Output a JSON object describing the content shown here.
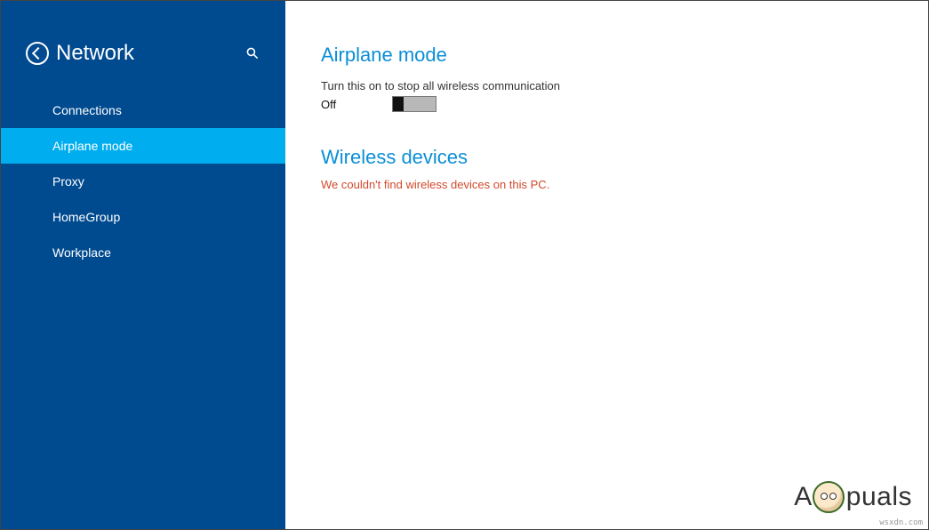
{
  "sidebar": {
    "title": "Network",
    "items": [
      {
        "label": "Connections",
        "active": false
      },
      {
        "label": "Airplane mode",
        "active": true
      },
      {
        "label": "Proxy",
        "active": false
      },
      {
        "label": "HomeGroup",
        "active": false
      },
      {
        "label": "Workplace",
        "active": false
      }
    ]
  },
  "content": {
    "airplane": {
      "heading": "Airplane mode",
      "description": "Turn this on to stop all wireless communication",
      "toggle_state": "Off"
    },
    "wireless": {
      "heading": "Wireless devices",
      "error": "We couldn't find wireless devices on this PC."
    }
  },
  "watermark": {
    "prefix": "A",
    "suffix": "puals"
  },
  "source": "wsxdn.com"
}
